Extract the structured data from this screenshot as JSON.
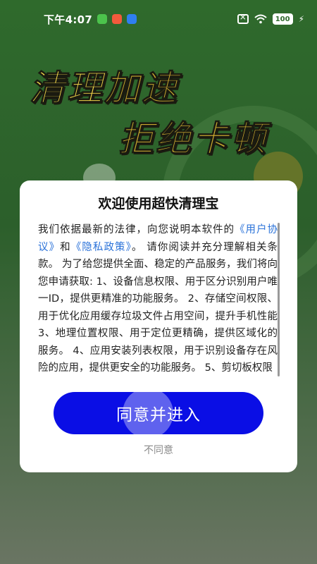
{
  "status_bar": {
    "time": "下午4:07",
    "battery": "100",
    "app_icon_colors": [
      "#4cc34c",
      "#f25a3c",
      "#2f7ff0"
    ],
    "icons": [
      "sim-off-icon",
      "wifi-icon",
      "battery-icon",
      "charging-icon"
    ]
  },
  "banner": {
    "line1_part1": "清理",
    "line1_part2": "加速",
    "line2": "拒绝卡顿"
  },
  "dialog": {
    "title": "欢迎使用超快清理宝",
    "body_prefix": "我们依据最新的法律，向您说明本软件的",
    "user_agreement_link": "《用户协议》",
    "and": "和",
    "privacy_link": "《隐私政策》",
    "body_text": "。 请你阅读并充分理解相关条款。 为了给您提供全面、稳定的产品服务，我们将向您申请获取: 1、设备信息权限、用于区分识别用户唯一ID，提供更精准的功能服务。 2、存储空间权限、用于优化应用缓存垃圾文件占用空间，提升手机性能 3、地理位置权限、用于定位更精确，提供区域化的服务。 4、应用安装列表权限，用于识别设备存在风险的应用，提供更安全的功能服务。 5、剪切板权限",
    "agree_button": "同意并进入",
    "disagree_link": "不同意"
  },
  "colors": {
    "background_green": "#2f6a2c",
    "primary_button": "#0a0ee5",
    "link_blue": "#2a72d9",
    "headline_gold": "#c9a930"
  }
}
